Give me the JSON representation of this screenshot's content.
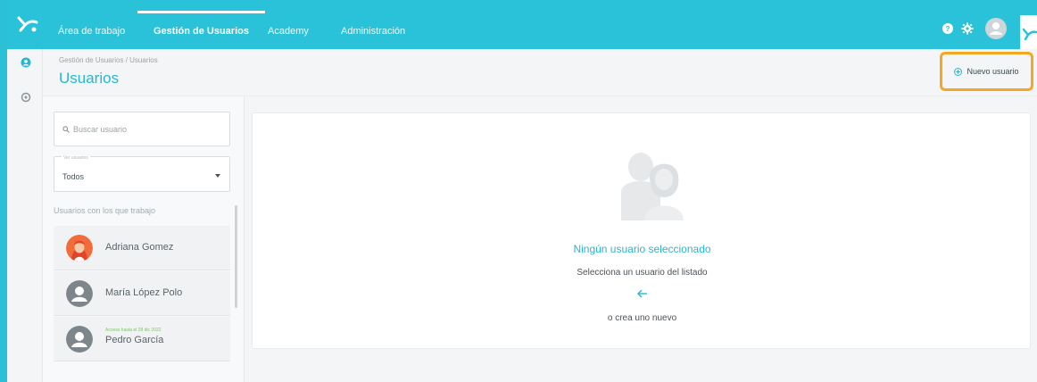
{
  "topbar": {
    "tabs": [
      {
        "label": "Área de trabajo",
        "active": false
      },
      {
        "label": "Gestión de Usuarios",
        "active": true
      },
      {
        "label": "Academy",
        "active": false
      },
      {
        "label": "Administración",
        "active": false
      }
    ],
    "icons": [
      "help-icon",
      "gear-icon",
      "user-avatar-icon"
    ]
  },
  "rail": {
    "icons": [
      "user-circle-icon",
      "settings-circle-icon"
    ]
  },
  "header": {
    "breadcrumb": "Gestión de Usuarios / Usuarios",
    "title": "Usuarios",
    "new_user_label": "Nuevo usuario"
  },
  "sidebar": {
    "search_placeholder": "Buscar usuario",
    "filter_label": "Ver usuarios",
    "filter_value": "Todos",
    "list_heading": "Usuarios con los que trabajo",
    "users": [
      {
        "name": "Adriana Gomez",
        "access": ""
      },
      {
        "name": "María López Polo",
        "access": ""
      },
      {
        "name": "Pedro García",
        "access": "Acceso hasta el 28 dic 2022"
      }
    ]
  },
  "main": {
    "empty_title": "Ningún usuario seleccionado",
    "empty_subtitle": "Selecciona un usuario del listado",
    "empty_or": "o crea uno nuevo"
  },
  "colors": {
    "brand": "#29c2d8",
    "accent": "#29b6cf",
    "highlight": "#f5a623",
    "access_green": "#7bc36a"
  }
}
